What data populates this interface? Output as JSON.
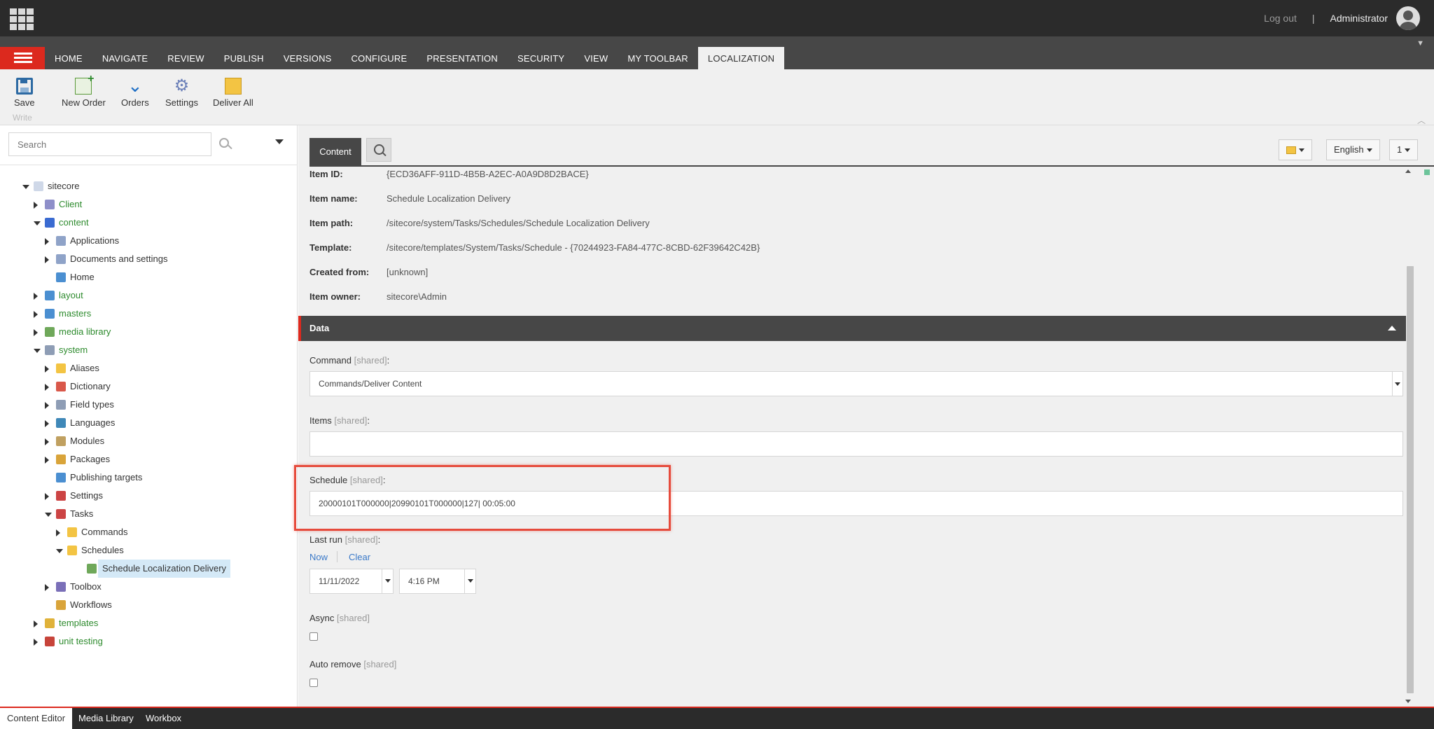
{
  "topbar": {
    "logout": "Log out",
    "separator": "|",
    "user": "Administrator"
  },
  "ribbon": {
    "tabs": [
      "HOME",
      "NAVIGATE",
      "REVIEW",
      "PUBLISH",
      "VERSIONS",
      "CONFIGURE",
      "PRESENTATION",
      "SECURITY",
      "VIEW",
      "MY TOOLBAR",
      "LOCALIZATION"
    ],
    "active_tab": "LOCALIZATION",
    "buttons": {
      "save": "Save",
      "new_order": "New Order",
      "orders": "Orders",
      "settings": "Settings",
      "deliver_all": "Deliver All"
    },
    "group_label": "Write"
  },
  "search": {
    "placeholder": "Search"
  },
  "tree": [
    {
      "label": "sitecore",
      "color": "dark"
    },
    {
      "label": "Client",
      "color": "green"
    },
    {
      "label": "content",
      "color": "green"
    },
    {
      "label": "Applications",
      "color": "dark"
    },
    {
      "label": "Documents and settings",
      "color": "dark"
    },
    {
      "label": "Home",
      "color": "dark"
    },
    {
      "label": "layout",
      "color": "green"
    },
    {
      "label": "masters",
      "color": "green"
    },
    {
      "label": "media library",
      "color": "green"
    },
    {
      "label": "system",
      "color": "green"
    },
    {
      "label": "Aliases",
      "color": "dark"
    },
    {
      "label": "Dictionary",
      "color": "dark"
    },
    {
      "label": "Field types",
      "color": "dark"
    },
    {
      "label": "Languages",
      "color": "dark"
    },
    {
      "label": "Modules",
      "color": "dark"
    },
    {
      "label": "Packages",
      "color": "dark"
    },
    {
      "label": "Publishing targets",
      "color": "dark"
    },
    {
      "label": "Settings",
      "color": "dark"
    },
    {
      "label": "Tasks",
      "color": "dark"
    },
    {
      "label": "Commands",
      "color": "dark"
    },
    {
      "label": "Schedules",
      "color": "dark"
    },
    {
      "label": "Schedule Localization Delivery",
      "color": "dark"
    },
    {
      "label": "Toolbox",
      "color": "dark"
    },
    {
      "label": "Workflows",
      "color": "dark"
    },
    {
      "label": "templates",
      "color": "green"
    },
    {
      "label": "unit testing",
      "color": "green"
    }
  ],
  "editor": {
    "tab": "Content",
    "language": "English",
    "version": "1",
    "info": {
      "item_id_label": "Item ID:",
      "item_id": "{ECD36AFF-911D-4B5B-A2EC-A0A9D8D2BACE}",
      "item_name_label": "Item name:",
      "item_name": "Schedule Localization Delivery",
      "item_path_label": "Item path:",
      "item_path": "/sitecore/system/Tasks/Schedules/Schedule Localization Delivery",
      "template_label": "Template:",
      "template": "/sitecore/templates/System/Tasks/Schedule - {70244923-FA84-477C-8CBD-62F39642C42B}",
      "created_from_label": "Created from:",
      "created_from": "[unknown]",
      "item_owner_label": "Item owner:",
      "item_owner": "sitecore\\Admin"
    },
    "section_title": "Data",
    "shared": "[shared]",
    "fields": {
      "command_label": "Command",
      "command_value": "Commands/Deliver Content",
      "items_label": "Items",
      "items_value": "",
      "schedule_label": "Schedule",
      "schedule_value": "20000101T000000|20990101T000000|127| 00:05:00",
      "last_run_label": "Last run",
      "now_link": "Now",
      "clear_link": "Clear",
      "last_run_date": "11/11/2022",
      "last_run_time": "4:16 PM",
      "async_label": "Async",
      "auto_remove_label": "Auto remove"
    }
  },
  "bottom_tabs": [
    "Content Editor",
    "Media Library",
    "Workbox"
  ],
  "colors": {
    "accent": "#dc291e",
    "dark_bar": "#2b2b2b",
    "tab_bar": "#474747",
    "link": "#3a79c8",
    "tree_green": "#2e8b2e",
    "highlight": "#e64b3c"
  }
}
